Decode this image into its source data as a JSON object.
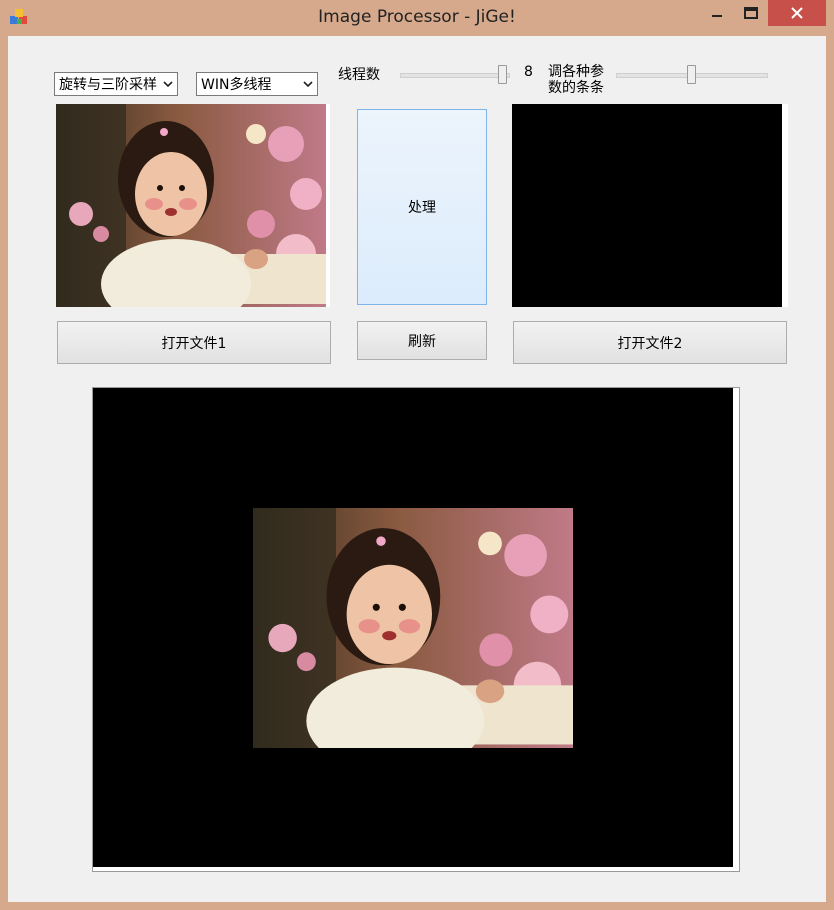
{
  "window": {
    "title": "Image Processor - JiGe!",
    "close_color": "#c7504a"
  },
  "toolbar": {
    "algorithm": {
      "selected": "旋转与三阶采样"
    },
    "threading": {
      "selected": "WIN多线程"
    },
    "threads_label": "线程数",
    "threads_value": "8",
    "threads_slider_level": 0.9,
    "params_label": "调各种参数的条条",
    "params_slider_level": 0.5
  },
  "buttons": {
    "process": "处理",
    "refresh": "刷新",
    "open1": "打开文件1",
    "open2": "打开文件2"
  },
  "images": {
    "input1": "photo of a smiling young girl in a white sweater in front of pink blossoms",
    "input2_state": "empty (black)",
    "output": "rotated/resampled photo of the girl centered on black background"
  }
}
